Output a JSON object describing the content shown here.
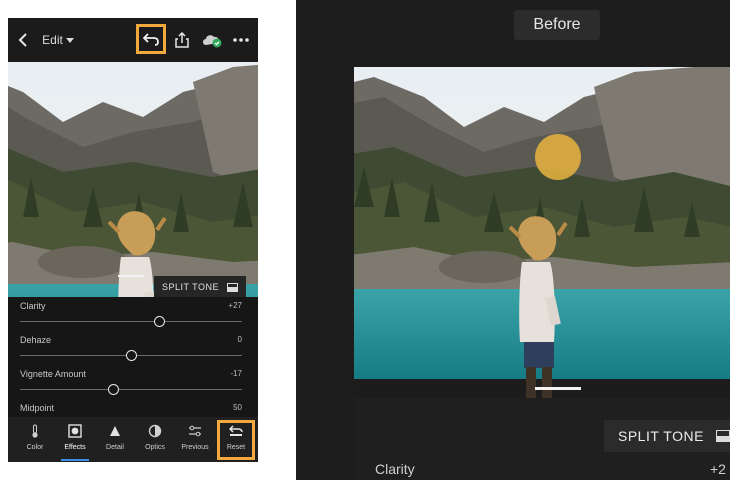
{
  "header": {
    "edit_label": "Edit"
  },
  "split_tone_label": "SPLIT TONE",
  "sliders": [
    {
      "label": "Clarity",
      "value": "+27",
      "level": 0.63
    },
    {
      "label": "Dehaze",
      "value": "0",
      "level": 0.5
    },
    {
      "label": "Vignette Amount",
      "value": "-17",
      "level": 0.42
    },
    {
      "label": "Midpoint",
      "value": "50",
      "level": 0.5
    }
  ],
  "tabs": [
    {
      "label": "Color",
      "icon": "thermometer-icon"
    },
    {
      "label": "Effects",
      "icon": "effects-icon",
      "active": true
    },
    {
      "label": "Detail",
      "icon": "triangle-icon"
    },
    {
      "label": "Optics",
      "icon": "lens-icon"
    },
    {
      "label": "Previous",
      "icon": "sliders-icon"
    },
    {
      "label": "Reset",
      "icon": "reset-icon"
    }
  ],
  "big_panel": {
    "before_label": "Before",
    "split_tone_label": "SPLIT TONE",
    "clarity_label": "Clarity",
    "clarity_value": "+2"
  },
  "colors": {
    "highlight": "#f2a93b",
    "active_tab": "#3d8ee8",
    "touch_indicator": "#e9b43e"
  }
}
